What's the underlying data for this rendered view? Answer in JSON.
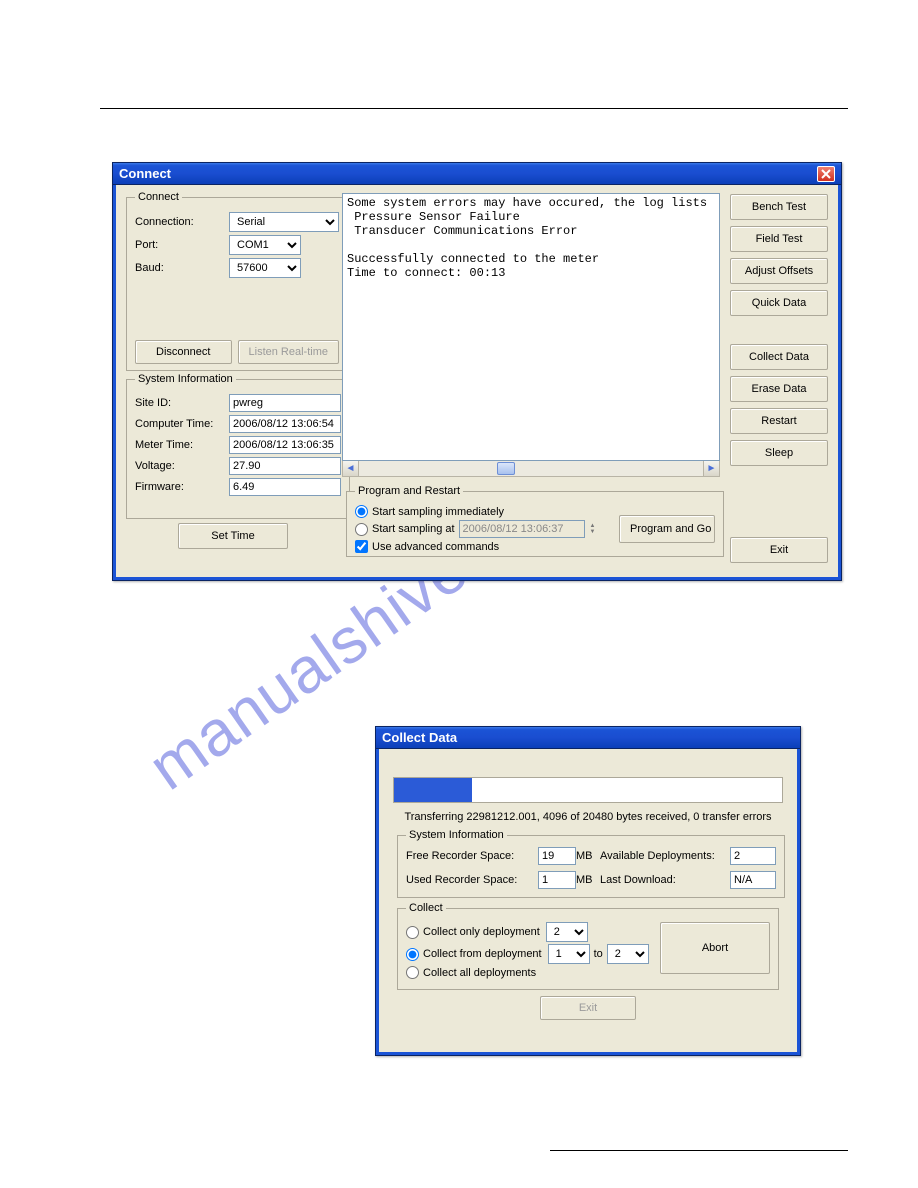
{
  "connect_window": {
    "title": "Connect",
    "close_label": "X",
    "connect_group": {
      "legend": "Connect",
      "connection_label": "Connection:",
      "connection_value": "Serial",
      "port_label": "Port:",
      "port_value": "COM1",
      "baud_label": "Baud:",
      "baud_value": "57600",
      "disconnect_btn": "Disconnect",
      "listen_btn": "Listen Real-time"
    },
    "sysinfo_group": {
      "legend": "System Information",
      "site_label": "Site ID:",
      "site_value": "pwreg",
      "comptime_label": "Computer Time:",
      "comptime_value": "2006/08/12 13:06:54",
      "metertime_label": "Meter Time:",
      "metertime_value": "2006/08/12 13:06:35",
      "voltage_label": "Voltage:",
      "voltage_value": "27.90",
      "firmware_label": "Firmware:",
      "firmware_value": "6.49",
      "settime_btn": "Set Time"
    },
    "log_text": "Some system errors may have occured, the log lists\n Pressure Sensor Failure\n Transducer Communications Error\n\nSuccessfully connected to the meter\nTime to connect: 00:13",
    "program_group": {
      "legend": "Program and Restart",
      "rb_immediate": "Start sampling immediately",
      "rb_at": "Start sampling at",
      "at_value": "2006/08/12 13:06:37",
      "cb_advanced": "Use advanced commands",
      "program_btn": "Program and Go"
    },
    "sidebar": [
      "Bench Test",
      "Field Test",
      "Adjust Offsets",
      "Quick Data"
    ],
    "sidebar2": [
      "Collect Data",
      "Erase Data",
      "Restart",
      "Sleep"
    ],
    "exit_btn": "Exit"
  },
  "collect_window": {
    "title": "Collect Data",
    "progress_pct": 20,
    "status": "Transferring 22981212.001, 4096 of 20480 bytes received, 0 transfer errors",
    "sysinfo": {
      "legend": "System Information",
      "free_label": "Free Recorder Space:",
      "free_value": "19",
      "mb1": "MB",
      "used_label": "Used Recorder Space:",
      "used_value": "1",
      "mb2": "MB",
      "avail_label": "Available Deployments:",
      "avail_value": "2",
      "last_label": "Last Download:",
      "last_value": "N/A"
    },
    "collect": {
      "legend": "Collect",
      "rb_only": "Collect only deployment",
      "only_value": "2",
      "rb_from": "Collect from deployment",
      "from_value": "1",
      "to_label": "to",
      "to_value": "2",
      "rb_all": "Collect all deployments",
      "abort_btn": "Abort"
    },
    "exit_btn": "Exit"
  }
}
